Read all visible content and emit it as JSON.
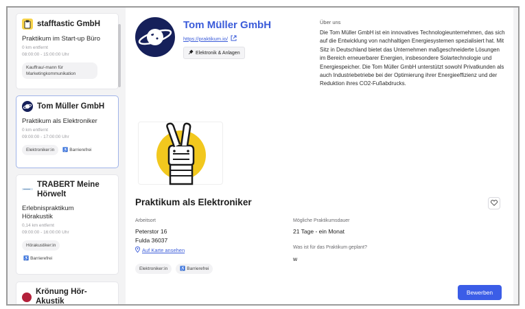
{
  "sidebar": {
    "cards": [
      {
        "company": "stafftastic GmbH",
        "title": "Praktikum im Start-up Büro",
        "distance": "0 km entfernt",
        "time": "08:00:00 - 15:00:00 Uhr",
        "tags": [
          "Kauffrau/-mann für Marketingkommunikation"
        ]
      },
      {
        "company": "Tom Müller GmbH",
        "title": "Praktikum als Elektroniker",
        "distance": "0 km entfernt",
        "time": "09:00:00 - 17:00:00 Uhr",
        "tags": [
          "Elektroniker:in",
          "Barrierefrei"
        ]
      },
      {
        "company": "TRABERT Meine Hörwelt",
        "title": "Erlebnispraktikum Hörakustik",
        "distance": "0,14 km entfernt",
        "time": "09:00:00 - 16:00:00 Uhr",
        "tags": [
          "Hörakustiker:in",
          "Barrierefrei"
        ]
      },
      {
        "company": "Krönung Hör-Akustik",
        "title": "",
        "distance": "",
        "time": "",
        "tags": []
      }
    ]
  },
  "company": {
    "name": "Tom Müller GmbH",
    "website": "https://praktikum.io/",
    "industry": "Elektronik & Anlagen",
    "about_label": "Über uns",
    "about_text": "Die Tom Müller GmbH ist ein innovatives Technologieunternehmen, das sich auf die Entwicklung von nachhaltigen Energiesystemen spezialisiert hat. Mit Sitz in Deutschland bietet das Unternehmen maßgeschneiderte Lösungen im Bereich erneuerbarer Energien, insbesondere Solartechnologie und Energiespeicher. Die Tom Müller GmbH unterstützt sowohl Privatkunden als auch Industriebetriebe bei der Optimierung ihrer Energieeffizienz und der Reduktion ihres CO2-Fußabdrucks."
  },
  "job": {
    "title": "Praktikum als Elektroniker",
    "location_label": "Arbeitsort",
    "street": "Peterstor 16",
    "city": "Fulda 36037",
    "map_link": "Auf Karte ansehen",
    "duration_label": "Mögliche Praktikumsdauer",
    "duration": "21 Tage - ein Monat",
    "plan_label": "Was ist für das Praktikum geplant?",
    "plan": "w",
    "tags": [
      "Elektroniker:in",
      "Barrierefrei"
    ],
    "apply_label": "Bewerben"
  },
  "colors": {
    "accent": "#3b5de7",
    "link": "#3a5bd9",
    "logo_navy": "#16205a",
    "picture_yellow": "#f2c81e"
  },
  "icons": {
    "external_link": "external-link-icon",
    "industry": "plug-icon",
    "map": "map-pin-icon",
    "favorite": "heart-icon",
    "accessible": "wheelchair-icon"
  }
}
